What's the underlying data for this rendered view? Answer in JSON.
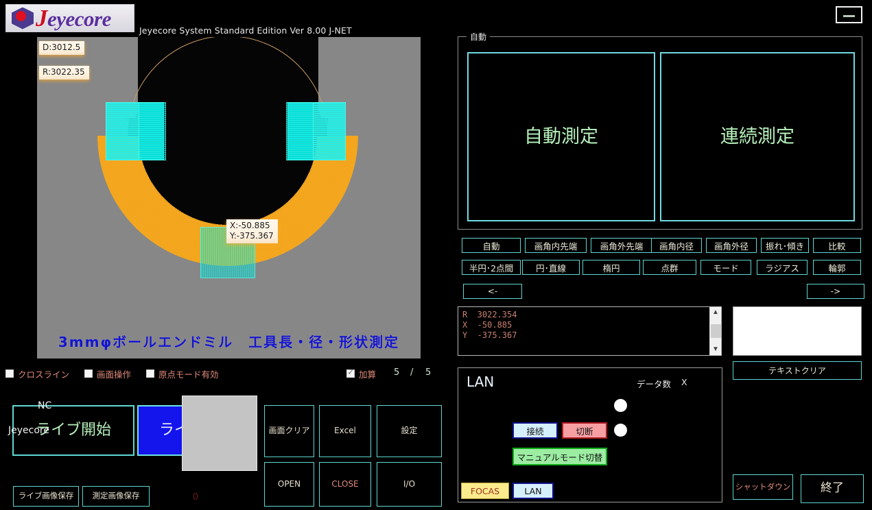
{
  "app": {
    "logo_text": "Jeyecore",
    "title": "Jeyecore System Standard Edition Ver 8.00 J-NET",
    "minimize_label": "minimize"
  },
  "viewport": {
    "labels": {
      "diameter": "D:3012.5",
      "radius": "R:3022.35",
      "point": "X:-50.885\nY:-375.367"
    },
    "caption": "3mmφボールエンドミル　工具長・径・形状測定",
    "colors": {
      "background": "#878787",
      "tool": "#050505",
      "band": "#eda51f",
      "hatch": "#28ece4",
      "caption": "#1414cf"
    }
  },
  "options": {
    "checkboxes": [
      {
        "label": "クロスライン",
        "checked": false
      },
      {
        "label": "画面操作",
        "checked": false
      },
      {
        "label": "原点モード有効",
        "checked": false
      }
    ],
    "add_checkbox": {
      "label": "加算",
      "checked": true
    },
    "counter_current": "5",
    "counter_separator": "/",
    "counter_total": "5"
  },
  "controls": {
    "live_start": "ライブ開始",
    "live_stop": "ライブ停止",
    "screen_clear": "画面クリア",
    "excel": "Excel",
    "settings": "設定",
    "open": "OPEN",
    "close": "CLOSE",
    "io": "I/O",
    "save_live_image": "ライブ画像保存",
    "save_measure_image": "測定画像保存",
    "zero_count": "0"
  },
  "auto_group": {
    "title": "自動",
    "auto_measure": "自動測定",
    "continuous_measure": "連続測定"
  },
  "mode_rows": {
    "row1": [
      "自動",
      "画角内先端",
      "画角外先端",
      "画角内径",
      "画角外径",
      "振れ･傾き",
      "比較"
    ],
    "row2": [
      "半円･2点間",
      "円･直線",
      "楕円",
      "点群",
      "モード",
      "ラジアス",
      "輪郭"
    ],
    "prev": "<-",
    "next": "->"
  },
  "results": {
    "text": "R  3022.354\nX  -50.885\nY  -375.367",
    "text_clear": "テキストクリア"
  },
  "lan": {
    "title": "LAN",
    "nc_label": "NC",
    "jeyecore_label": "Jeyecore",
    "data_count_label": "データ数",
    "data_x_label": "X",
    "connect": "接続",
    "disconnect": "切断",
    "manual_mode": "マニュアルモード切替",
    "focas": "FOCAS",
    "lan_tab": "LAN"
  },
  "system": {
    "shutdown": "シャットダウン",
    "exit": "終了"
  }
}
